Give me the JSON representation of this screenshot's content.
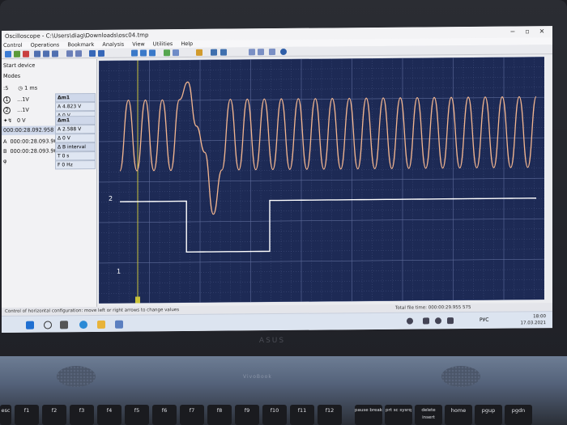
{
  "window": {
    "title": "Oscilloscope - C:\\Users\\diag\\Downloads\\osc04.tmp",
    "minimize": "−",
    "maximize": "▫",
    "close": "✕"
  },
  "menu": [
    "Control",
    "Operations",
    "Bookmark",
    "Analysis",
    "View",
    "Utilities",
    "Help"
  ],
  "left_panel": {
    "start_device": "Start device",
    "modes": "Modes",
    "timebase_prefix": ":5",
    "timebase_value": "1 ms",
    "ch1_label": "1",
    "ch1_value": "...1V",
    "ch2_label": "2",
    "ch2_value": "...1V",
    "trigger_value": "0 V",
    "time_readout": "000:00:28.092.958",
    "cursor_a_label": "A",
    "cursor_a_value": "000:00:28.093.960",
    "cursor_b_label": "B",
    "cursor_b_value": "000:00:28.093.960",
    "phi_label": "φ"
  },
  "cursor_boxes": {
    "box1_header": "Δm1",
    "box1_line1": "A 4.823 V",
    "box1_line2": "Δ 0 V",
    "box2_header": "Δm1",
    "box2_line1": "A 2.588 V",
    "box2_line2": "Δ 0 V",
    "box3_header": "Δ B interval",
    "box3_line1": "T 0 s",
    "box3_line2": "F 0 Hz"
  },
  "plot": {
    "marker_ch2": "2",
    "marker_ch1": "1",
    "colors": {
      "background": "#1d2a55",
      "grid": "#5e6c9a",
      "ch1": "#ffffff",
      "ch2": "#f2b58f",
      "cursor": "#c9c23a"
    }
  },
  "chart_data": {
    "type": "line",
    "series": [
      {
        "name": "",
        "values": [
          1.3,
          1.3,
          1.3,
          1.3,
          1.3,
          1.3,
          1.3,
          1.3,
          0.15,
          0.15,
          0.15,
          0.15,
          0.15,
          0.15,
          0.15,
          0.15,
          0.15,
          0.15,
          1.3,
          1.3,
          1.3,
          1.3,
          1.3,
          1.3,
          1.3,
          1.3,
          1.3,
          1.3,
          1.3,
          1.3,
          1.3,
          1.3,
          1.3,
          1.3,
          1.3,
          1.3,
          1.3,
          1.3,
          1.3,
          1.3,
          1.3,
          1.3,
          1.3,
          1.3,
          1.3,
          1.3,
          1.3,
          1.3,
          1.3,
          1.3
        ]
      },
      {
        "name": "",
        "values": [
          2.0,
          3.6,
          2.0,
          3.6,
          2.0,
          3.6,
          2.0,
          3.6,
          4.0,
          3.0,
          2.4,
          1.0,
          2.0,
          3.6,
          2.0,
          3.6,
          2.0,
          3.6,
          2.0,
          3.6,
          2.0,
          3.6,
          2.0,
          3.6,
          2.0,
          3.6,
          2.0,
          3.6,
          2.0,
          3.6,
          2.0,
          3.6,
          2.0,
          3.6,
          2.0,
          3.6,
          2.0,
          3.6,
          2.0,
          3.6,
          2.0,
          3.6,
          2.0,
          3.6,
          2.0,
          3.6,
          2.0,
          3.6,
          2.0,
          3.6
        ]
      }
    ],
    "ylim": [
      -1,
      4.5
    ]
  },
  "status": {
    "left": "Control of horizontal configuration: move left or right arrows to change values",
    "right": "Total file time: 000:00:29.955 575"
  },
  "taskbar": {
    "lang": "РУС",
    "time": "18:00",
    "date": "17.03.2021"
  },
  "brand": "ASUS",
  "deck_label": "VivoBook",
  "keys": {
    "esc": "esc",
    "f1": "f1",
    "f2": "f2",
    "f3": "f3",
    "f4": "f4",
    "f5": "f5",
    "f6": "f6",
    "f7": "f7",
    "f8": "f8",
    "f9": "f9",
    "f10": "f10",
    "f11": "f11",
    "f12": "f12",
    "pause": "pause break",
    "prtsc": "prt sc sysrq",
    "delete": "delete insert",
    "home": "home",
    "pgup": "pgup",
    "pgdn": "pgdn"
  }
}
